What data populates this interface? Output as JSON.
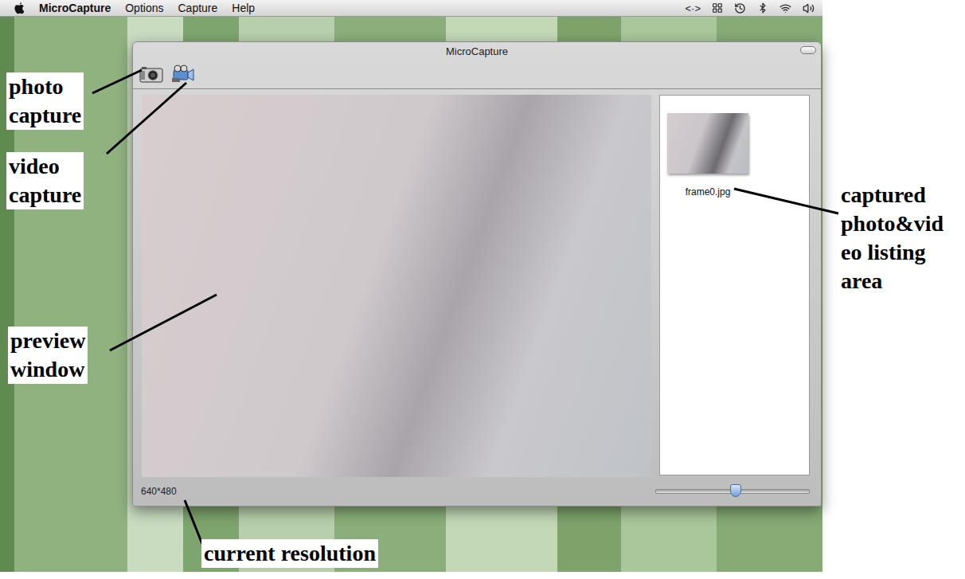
{
  "menu_bar": {
    "app": "MicroCapture",
    "menus": [
      "Options",
      "Capture",
      "Help"
    ],
    "status": "<·>"
  },
  "window": {
    "title": "MicroCapture"
  },
  "captures": [
    {
      "file": "frame0.jpg",
      "selected": false
    }
  ],
  "status_bar": {
    "resolution": "640*480",
    "zoom": {
      "level": 0.52
    }
  },
  "annotations": [
    {
      "lines": [
        "photo",
        "capture"
      ]
    },
    {
      "lines": [
        "video",
        "capture"
      ]
    },
    {
      "lines": [
        "preview",
        "window"
      ]
    },
    {
      "lines": [
        "current resolution"
      ]
    },
    {
      "lines": [
        "captured",
        "photo&vid",
        "eo listing",
        "area"
      ]
    }
  ]
}
